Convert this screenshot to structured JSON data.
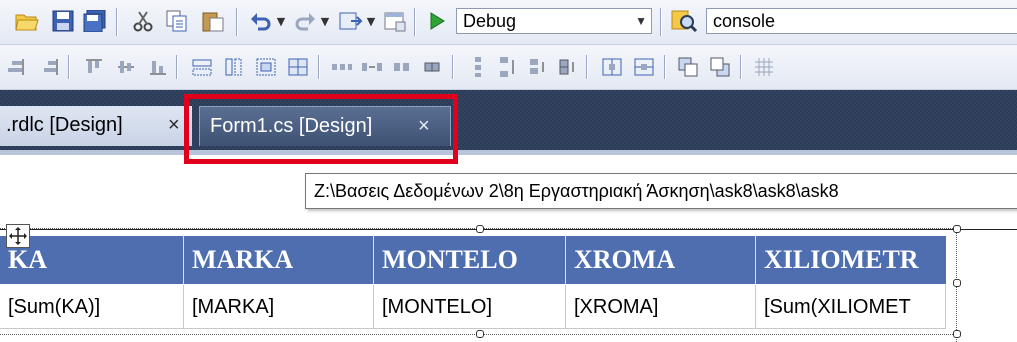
{
  "toolbar": {
    "configuration_value": "Debug",
    "platform_value": "console",
    "icons": [
      "open-folder-icon",
      "save-icon",
      "save-all-icon",
      "cut-icon",
      "copy-icon",
      "paste-icon",
      "undo-icon",
      "redo-icon",
      "navigate-icon",
      "layout-icon",
      "start-debugging-icon",
      "find-in-files-icon"
    ]
  },
  "tabs": [
    {
      "label": ".rdlc [Design]",
      "close": "×",
      "active": false
    },
    {
      "label": "Form1.cs [Design]",
      "close": "×",
      "active": true
    }
  ],
  "tooltip": {
    "text": "Z:\\Βασεις Δεδομένων 2\\8η Εργαστηριακή Άσκηση\\ask8\\ask8\\ask8"
  },
  "report_table": {
    "headers": [
      "KA",
      "MARKA",
      "MONTELO",
      "XROMA",
      "XILIOMETR"
    ],
    "cells": [
      "[Sum(KA)]",
      "[MARKA]",
      "[MONTELO]",
      "[XROMA]",
      "[Sum(XILIOMET"
    ]
  },
  "colors": {
    "tab_strip": "#2b3c59",
    "active_tab": "#4a5e82",
    "highlight": "#e0001b",
    "table_header": "#4f6eb0"
  }
}
